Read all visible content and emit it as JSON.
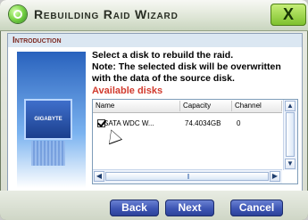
{
  "window": {
    "title": "Rebuilding Raid Wizard",
    "close_label": "X"
  },
  "section": {
    "header": "Introduction"
  },
  "left_image": {
    "chip_text": "GIGABYTE"
  },
  "instructions": {
    "line1": "Select a disk to rebuild the raid.",
    "line2": "Note: The selected disk will be overwritten",
    "line3": "with the data of the source disk."
  },
  "disks": {
    "label": "Available disks",
    "columns": [
      "Name",
      "Capacity",
      "Channel"
    ],
    "rows": [
      {
        "checked": true,
        "name": "SATA   WDC W...",
        "capacity": "74.4034GB",
        "channel": "0"
      }
    ]
  },
  "buttons": {
    "back": "Back",
    "next": "Next",
    "cancel": "Cancel"
  },
  "colors": {
    "section_header_text": "#7d2a22",
    "available_label": "#d23b2e",
    "button_blue": "#3d55b3",
    "accent_green": "#7bbf2a"
  }
}
